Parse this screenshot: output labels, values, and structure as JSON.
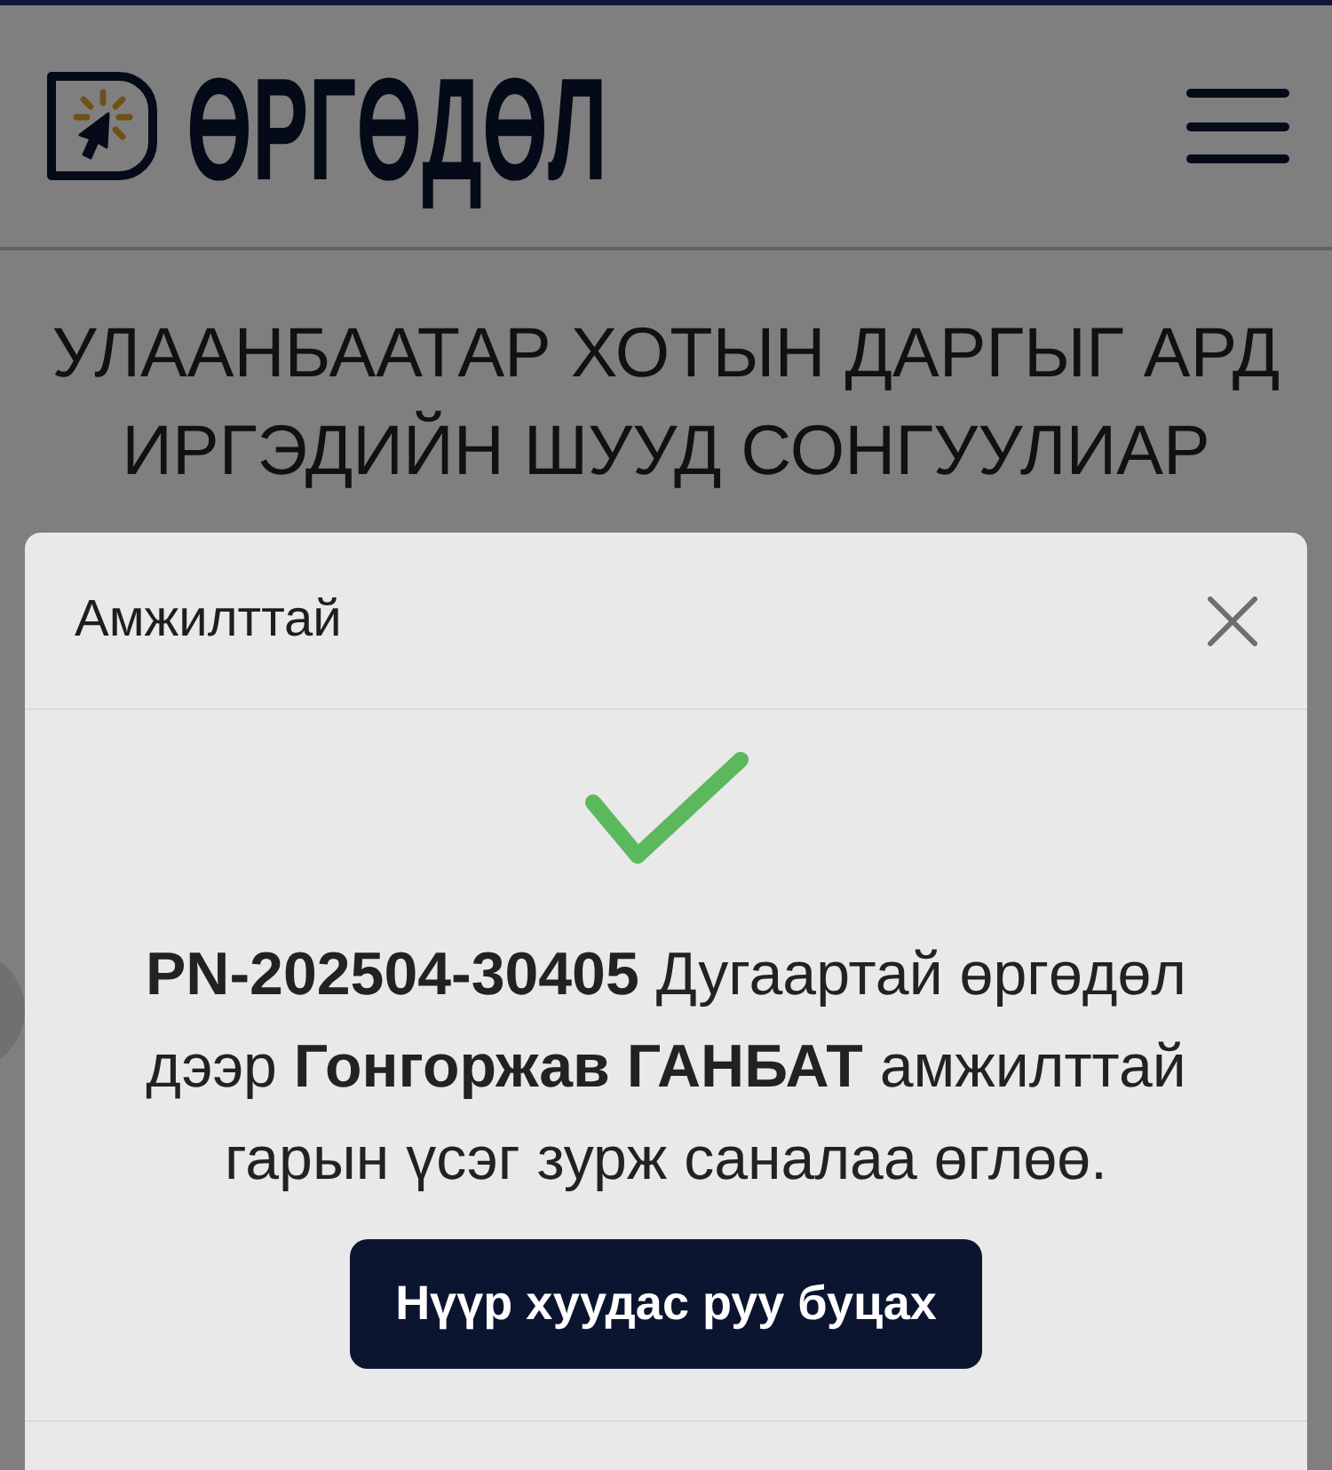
{
  "header": {
    "logo_text": "ӨРГӨДӨЛ"
  },
  "page": {
    "title": "УЛААНБААТАР ХОТЫН ДАРГЫГ АРД ИРГЭДИЙН ШУУД СОНГУУЛИАР"
  },
  "dialog": {
    "title": "Амжилттай",
    "message": "**PN-202504-30405** Дугаартай өргөдөл дээр **Гонгоржав ГАНБАТ** амжилттай гарын үсэг зурж саналаа өглөө.",
    "button": "Нүүр хуудас руу буцах"
  }
}
